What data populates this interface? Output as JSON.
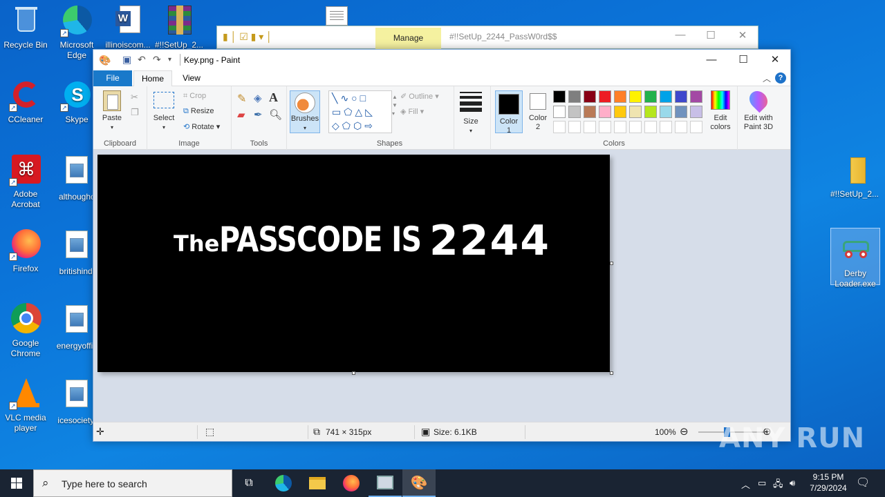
{
  "desktop": {
    "left_col": [
      {
        "label": "Recycle Bin"
      },
      {
        "label": "CCleaner"
      },
      {
        "label": "Adobe Acrobat"
      },
      {
        "label": "Firefox"
      },
      {
        "label": "Google Chrome"
      },
      {
        "label": "VLC media player"
      }
    ],
    "second_col": [
      {
        "label": "Microsoft Edge"
      },
      {
        "label": "Skype"
      },
      {
        "label": "althoughc"
      },
      {
        "label": "britishindi"
      },
      {
        "label": "energyoffic"
      },
      {
        "label": "icesociety."
      }
    ],
    "top_row": [
      {
        "label": "illinoiscom..."
      },
      {
        "label": "#!!SetUp_2..."
      }
    ],
    "right": [
      {
        "label": "#!!SetUp_2..."
      },
      {
        "label": "Derby Loader.exe"
      }
    ]
  },
  "explorer": {
    "manage_tab": "Manage",
    "title": "#!!SetUp_2244_PassW0rd$$"
  },
  "paint": {
    "title": "Key.png - Paint",
    "tabs": {
      "file": "File",
      "home": "Home",
      "view": "View"
    },
    "ribbon": {
      "clipboard": {
        "paste": "Paste",
        "group": "Clipboard"
      },
      "image": {
        "select": "Select",
        "crop": "Crop",
        "resize": "Resize",
        "rotate": "Rotate",
        "group": "Image"
      },
      "tools": {
        "group": "Tools"
      },
      "brushes": "Brushes",
      "shapes": {
        "outline": "Outline",
        "fill": "Fill",
        "group": "Shapes"
      },
      "size": "Size",
      "colors": {
        "color1": "Color\n1",
        "color2": "Color\n2",
        "edit": "Edit\ncolors",
        "group": "Colors",
        "palette_row1": [
          "#000000",
          "#7f7f7f",
          "#880015",
          "#ed1c24",
          "#ff7f27",
          "#fff200",
          "#22b14c",
          "#00a2e8",
          "#3f48cc",
          "#a349a4"
        ],
        "palette_row2": [
          "#ffffff",
          "#c3c3c3",
          "#b97a57",
          "#ffaec9",
          "#ffc90e",
          "#efe4b0",
          "#b5e61d",
          "#99d9ea",
          "#7092be",
          "#c8bfe7"
        ]
      },
      "paint3d": "Edit with\nPaint 3D"
    },
    "image_text": {
      "the": "The",
      "passcode": "PASSCODE IS",
      "number": "2244"
    },
    "status": {
      "dimensions": "741 × 315px",
      "size": "Size: 6.1KB",
      "zoom": "100%"
    }
  },
  "taskbar": {
    "search_placeholder": "Type here to search",
    "time": "9:15 PM",
    "date": "7/29/2024"
  },
  "watermark": "ANY RUN"
}
